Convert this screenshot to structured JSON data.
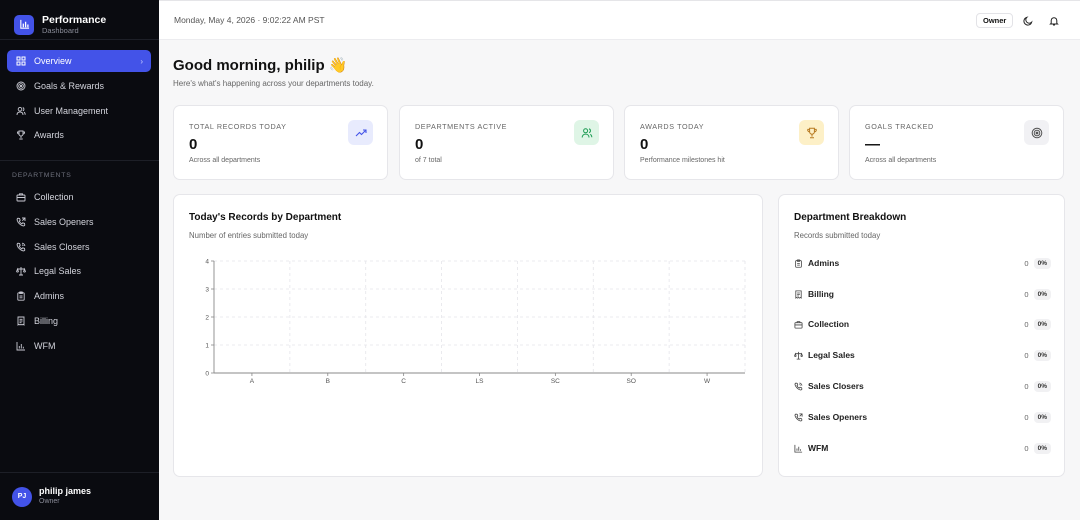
{
  "brand": {
    "title": "Performance",
    "subtitle": "Dashboard",
    "icon": "bar-chart-icon"
  },
  "sidebar": {
    "main_items": [
      {
        "label": "Overview",
        "icon": "grid-icon",
        "active": true
      },
      {
        "label": "Goals & Rewards",
        "icon": "target-icon"
      },
      {
        "label": "User Management",
        "icon": "users-icon"
      },
      {
        "label": "Awards",
        "icon": "trophy-icon"
      }
    ],
    "section_heading": "DEPARTMENTS",
    "departments": [
      {
        "label": "Collection",
        "icon": "briefcase-icon"
      },
      {
        "label": "Sales Openers",
        "icon": "phone-outgoing-icon"
      },
      {
        "label": "Sales Closers",
        "icon": "phone-call-icon"
      },
      {
        "label": "Legal Sales",
        "icon": "scale-icon"
      },
      {
        "label": "Admins",
        "icon": "clipboard-icon"
      },
      {
        "label": "Billing",
        "icon": "receipt-icon"
      },
      {
        "label": "WFM",
        "icon": "bar-chart-icon"
      }
    ],
    "user": {
      "initials": "PJ",
      "name": "philip james",
      "role": "Owner"
    }
  },
  "header": {
    "datetime": "Monday, May 4, 2026 · 9:02:22 AM PST",
    "role_badge": "Owner"
  },
  "greeting": {
    "title": "Good morning, philip 👋",
    "subtitle": "Here's what's happening across your departments today."
  },
  "stats": [
    {
      "label": "TOTAL RECORDS TODAY",
      "value": "0",
      "note": "Across all departments",
      "icon": "trending-up-icon",
      "icon_bg": "#e8ebfd",
      "icon_color": "#4353e8"
    },
    {
      "label": "DEPARTMENTS ACTIVE",
      "value": "0",
      "note": "of 7 total",
      "icon": "users-icon",
      "icon_bg": "#dff5e6",
      "icon_color": "#1f9d55"
    },
    {
      "label": "AWARDS TODAY",
      "value": "0",
      "note": "Performance milestones hit",
      "icon": "trophy-icon",
      "icon_bg": "#fdf0c7",
      "icon_color": "#b7791f"
    },
    {
      "label": "GOALS TRACKED",
      "value": "—",
      "note": "Across all departments",
      "icon": "target-icon",
      "icon_bg": "#f1f1f4",
      "icon_color": "#555"
    }
  ],
  "records_chart": {
    "title": "Today's Records by Department",
    "subtitle": "Number of entries submitted today"
  },
  "chart_data": {
    "type": "bar",
    "categories": [
      "A",
      "B",
      "C",
      "LS",
      "SC",
      "SO",
      "W"
    ],
    "values": [
      0,
      0,
      0,
      0,
      0,
      0,
      0
    ],
    "yticks": [
      "0",
      "1",
      "2",
      "3",
      "4"
    ],
    "ylim": [
      0,
      4
    ],
    "grid": true
  },
  "breakdown": {
    "title": "Department Breakdown",
    "subtitle": "Records submitted today",
    "rows": [
      {
        "name": "Admins",
        "count": "0",
        "pct": "0%",
        "icon": "clipboard-icon"
      },
      {
        "name": "Billing",
        "count": "0",
        "pct": "0%",
        "icon": "receipt-icon"
      },
      {
        "name": "Collection",
        "count": "0",
        "pct": "0%",
        "icon": "briefcase-icon"
      },
      {
        "name": "Legal Sales",
        "count": "0",
        "pct": "0%",
        "icon": "scale-icon"
      },
      {
        "name": "Sales Closers",
        "count": "0",
        "pct": "0%",
        "icon": "phone-call-icon"
      },
      {
        "name": "Sales Openers",
        "count": "0",
        "pct": "0%",
        "icon": "phone-outgoing-icon"
      },
      {
        "name": "WFM",
        "count": "0",
        "pct": "0%",
        "icon": "bar-chart-icon"
      }
    ]
  }
}
